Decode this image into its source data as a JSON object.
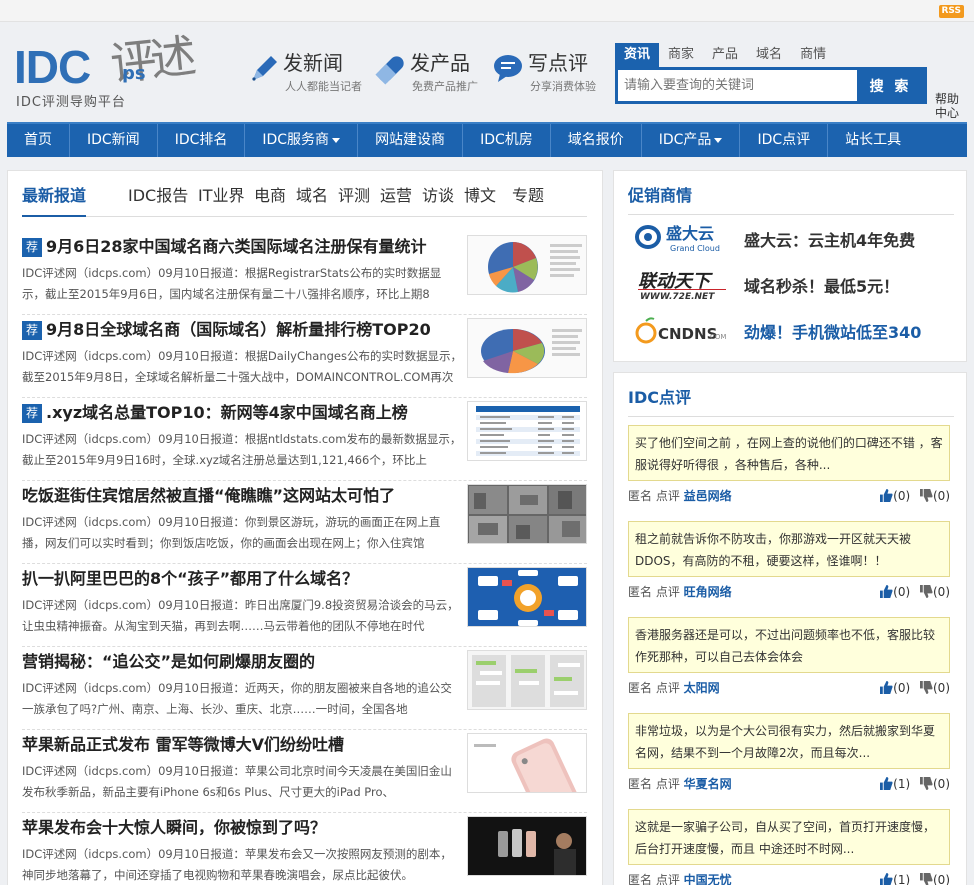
{
  "topbar": {
    "rss": "RSS"
  },
  "logo": {
    "text": "IDC",
    "suffix": "ps",
    "calligraphy": "评述",
    "slogan": "IDC评测导购平台"
  },
  "header_links": [
    {
      "title": "发新闻",
      "sub": "人人都能当记者",
      "icon": "pen-icon"
    },
    {
      "title": "发产品",
      "sub": "免费产品推广",
      "icon": "capsule-icon"
    },
    {
      "title": "写点评",
      "sub": "分享消费体验",
      "icon": "chat-bubble-icon"
    }
  ],
  "search": {
    "tabs": [
      "资讯",
      "商家",
      "产品",
      "域名",
      "商情"
    ],
    "active_tab": "资讯",
    "placeholder": "请输入要查询的关键词",
    "button": "搜 索",
    "help": "帮助中心"
  },
  "nav": {
    "items": [
      {
        "label": "首页"
      },
      {
        "label": "IDC新闻"
      },
      {
        "label": "IDC排名"
      },
      {
        "label": "IDC服务商",
        "dropdown": true
      },
      {
        "label": "网站建设商"
      },
      {
        "label": "IDC机房"
      },
      {
        "label": "域名报价"
      },
      {
        "label": "IDC产品",
        "dropdown": true
      },
      {
        "label": "IDC点评"
      },
      {
        "label": "站长工具"
      }
    ]
  },
  "news": {
    "tabs": [
      "最新报道",
      "IDC报告",
      "IT业界",
      "电商",
      "域名",
      "评测",
      "运营",
      "访谈",
      "博文",
      "专题"
    ],
    "active_tab": "最新报道",
    "badge": "荐",
    "items": [
      {
        "title": "9月6日28家中国域名商六类国际域名注册保有量统计",
        "recommended": true,
        "summary": "IDC评述网（idcps.com）09月10日报道：根据RegistrarStats公布的实时数据显示，截止至2015年9月6日，国内域名注册保有量二十八强排名顺序，环比上期8",
        "thumb": "pie-chart"
      },
      {
        "title": "9月8日全球域名商（国际域名）解析量排行榜TOP20",
        "recommended": true,
        "summary": "IDC评述网（idcps.com）09月10日报道：根据DailyChanges公布的实时数据显示，截至2015年9月8日，全球域名解析量二十强大战中，DOMAINCONTROL.COM再次",
        "thumb": "pie-chart"
      },
      {
        "title": ".xyz域名总量TOP10：新网等4家中国域名商上榜",
        "recommended": true,
        "summary": "IDC评述网（idcps.com）09月10日报道：根据ntldstats.com发布的最新数据显示，截止至2015年9月9日16时，全球.xyz域名注册总量达到1,121,466个，环比上",
        "thumb": "table"
      },
      {
        "title": "吃饭逛街住宾馆居然被直播“俺瞧瞧”这网站太可怕了",
        "recommended": false,
        "summary": "IDC评述网（idcps.com）09月10日报道：你到景区游玩，游玩的画面正在网上直播，网友们可以实时看到；你到饭店吃饭，你的画面会出现在网上；你入住宾馆",
        "thumb": "cctv-grid"
      },
      {
        "title": "扒一扒阿里巴巴的8个“孩子”都用了什么域名？",
        "recommended": false,
        "summary": "IDC评述网（idcps.com）09月10日报道：昨日出席厦门9.8投资贸易洽谈会的马云，让虫虫精神振奋。从淘宝到天猫，再到去啊……马云带着他的团队不停地在时代",
        "thumb": "infographic"
      },
      {
        "title": "营销揭秘：“追公交”是如何刷爆朋友圈的",
        "recommended": false,
        "summary": "IDC评述网（idcps.com）09月10日报道：近两天，你的朋友圈被来自各地的追公交一族承包了吗?广州、南京、上海、长沙、重庆、北京……一时间，全国各地",
        "thumb": "chat-screens"
      },
      {
        "title": "苹果新品正式发布 雷军等微博大V们纷纷吐槽",
        "recommended": false,
        "summary": "IDC评述网（idcps.com）09月10日报道：苹果公司北京时间今天凌晨在美国旧金山发布秋季新品，新品主要有iPhone 6s和6s Plus、尺寸更大的iPad Pro、",
        "thumb": "phone"
      },
      {
        "title": "苹果发布会十大惊人瞬间，你被惊到了吗？",
        "recommended": false,
        "summary": "IDC评述网（idcps.com）09月10日报道：苹果发布会又一次按照网友预测的剧本，神同步地落幕了，中间还穿插了电视购物和苹果春晚演唱会，尿点比起彼伏。",
        "thumb": "stage"
      }
    ]
  },
  "promotions": {
    "title": "促销商情",
    "items": [
      {
        "brand": "盛大云",
        "brand_sub": "Grand Cloud",
        "text": "盛大云：云主机4年免费",
        "color": "#333333"
      },
      {
        "brand": "联动天下",
        "brand_sub": "WWW.72E.NET",
        "text": "域名秒杀！最低5元！",
        "color": "#333333"
      },
      {
        "brand": "CNDNS",
        "brand_sub": "COM",
        "text": "劲爆！手机微站低至340",
        "color": "#1b5da6"
      }
    ]
  },
  "reviews": {
    "title": "IDC点评",
    "anon_label": "匿名 点评",
    "items": [
      {
        "text": "买了他们空间之前 ，在网上查的说他们的口碑还不错 ，客服说得好听得很 ，各种售后，各种...",
        "target": "益邑网络",
        "up": "(0)",
        "down": "(0)"
      },
      {
        "text": "租之前就告诉你不防攻击，你那游戏一开区就天天被DDOS，有高防的不租，硬要这样，怪谁啊！！",
        "target": "旺角网络",
        "up": "(0)",
        "down": "(0)"
      },
      {
        "text": "香港服务器还是可以，不过出问题频率也不低，客服比较作死那种，可以自己去体会体会",
        "target": "太阳网",
        "up": "(0)",
        "down": "(0)"
      },
      {
        "text": "非常垃圾，以为是个大公司很有实力，然后就搬家到华夏名网，结果不到一个月故障2次，而且每次...",
        "target": "华夏名网",
        "up": "(1)",
        "down": "(0)"
      },
      {
        "text": "这就是一家骗子公司，自从买了空间，首页打开速度慢，后台打开速度慢，而且 中途还时不时网...",
        "target": "中国无忧",
        "up": "(1)",
        "down": "(0)"
      }
    ]
  }
}
